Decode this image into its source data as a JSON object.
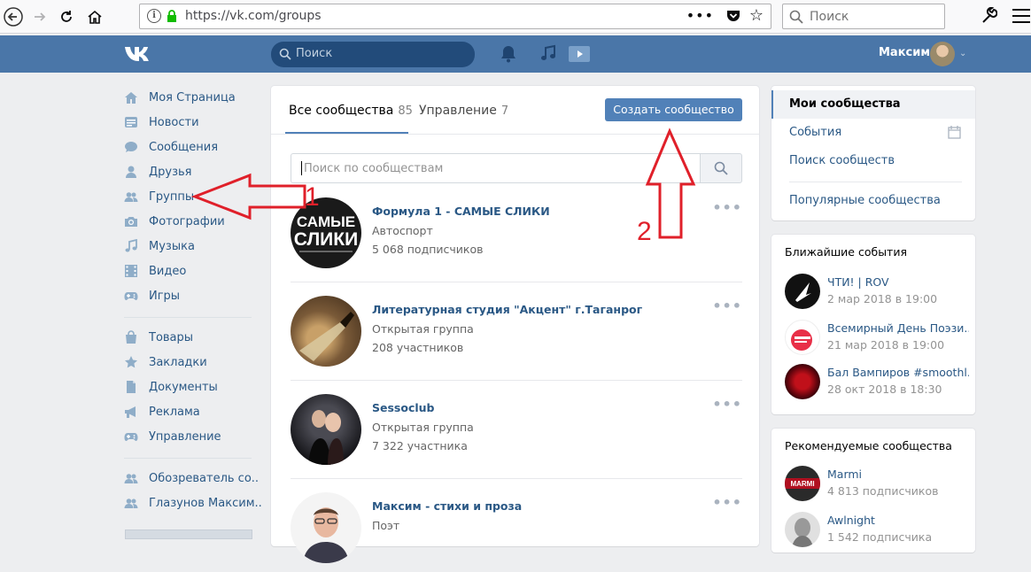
{
  "browser": {
    "url": "https://vk.com/groups",
    "search_placeholder": "Поиск"
  },
  "header": {
    "search_placeholder": "Поиск",
    "user_name": "Максим"
  },
  "sidebar": {
    "items": [
      {
        "label": "Моя Страница",
        "icon": "home-icon"
      },
      {
        "label": "Новости",
        "icon": "news-icon"
      },
      {
        "label": "Сообщения",
        "icon": "messages-icon"
      },
      {
        "label": "Друзья",
        "icon": "friends-icon"
      },
      {
        "label": "Группы",
        "icon": "groups-icon"
      },
      {
        "label": "Фотографии",
        "icon": "camera-icon"
      },
      {
        "label": "Музыка",
        "icon": "music-icon"
      },
      {
        "label": "Видео",
        "icon": "video-icon"
      },
      {
        "label": "Игры",
        "icon": "gamepad-icon"
      },
      {
        "label": "Товары",
        "icon": "bag-icon"
      },
      {
        "label": "Закладки",
        "icon": "star-icon"
      },
      {
        "label": "Документы",
        "icon": "document-icon"
      },
      {
        "label": "Реклама",
        "icon": "megaphone-icon"
      },
      {
        "label": "Управление",
        "icon": "gamepad-icon"
      },
      {
        "label": "Обозреватель со..",
        "icon": "groups-icon"
      },
      {
        "label": "Глазунов Максим..",
        "icon": "groups-icon"
      }
    ]
  },
  "main": {
    "tabs": [
      {
        "label": "Все сообщества",
        "count": "85"
      },
      {
        "label": "Управление",
        "count": "7"
      }
    ],
    "create_button": "Создать сообщество",
    "search_placeholder": "Поиск по сообществам",
    "groups": [
      {
        "name": "Формула 1 - САМЫЕ СЛИКИ",
        "type": "Автоспорт",
        "subs": "5 068 подписчиков",
        "avatar_text": "САМЫЕ СЛИКИ"
      },
      {
        "name": "Литературная студия \"Акцент\" г.Таганрог",
        "type": "Открытая группа",
        "subs": "208 участников"
      },
      {
        "name": "Sessoclub",
        "type": "Открытая группа",
        "subs": "7 322 участника"
      },
      {
        "name": "Максим - стихи и проза",
        "type": "Поэт",
        "subs": ""
      }
    ]
  },
  "right": {
    "nav": [
      "Мои сообщества",
      "События",
      "Поиск сообществ",
      "Популярные сообщества"
    ],
    "events_title": "Ближайшие события",
    "events": [
      {
        "title": "ЧТИ! | ROV",
        "date": "2 мар 2018 в 19:00"
      },
      {
        "title": "Всемирный День Поэзи..",
        "date": "21 мар 2018 в 19:00"
      },
      {
        "title": "Бал Вампиров #smoothl..",
        "date": "28 окт 2018 в 18:30"
      }
    ],
    "rec_title": "Рекомендуемые сообщества",
    "recommended": [
      {
        "title": "Marmi",
        "subs": "4 813 подписчиков",
        "avatar_text": "MARMI"
      },
      {
        "title": "Awlnight",
        "subs": "1 542 подписчика"
      }
    ]
  },
  "annotations": {
    "label_1": "1",
    "label_2": "2",
    "color": "#e0202a"
  }
}
